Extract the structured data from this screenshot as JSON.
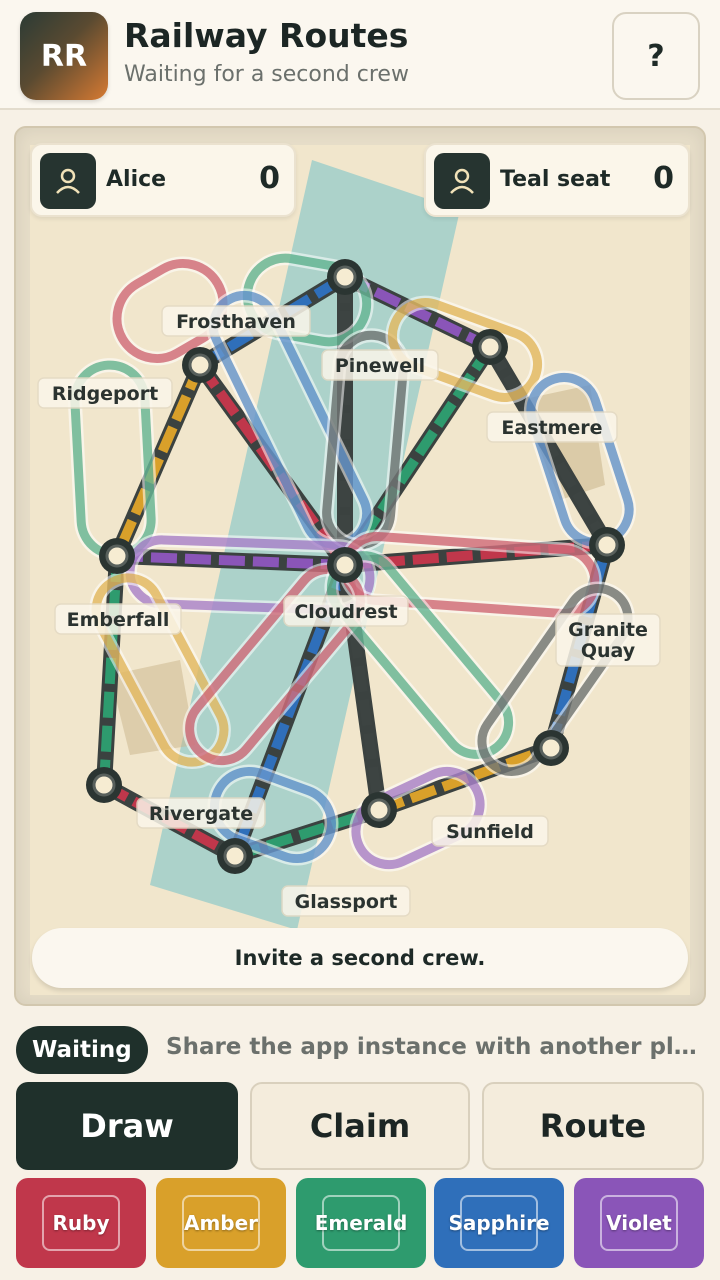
{
  "header": {
    "logo_text": "RR",
    "title": "Railway Routes",
    "subtitle": "Waiting for a second crew",
    "help_label": "?"
  },
  "players": [
    {
      "name": "Alice",
      "score": "0"
    },
    {
      "name": "Teal seat",
      "score": "0"
    }
  ],
  "cities": [
    {
      "name": "Frosthaven"
    },
    {
      "name": "Pinewell"
    },
    {
      "name": "Ridgeport"
    },
    {
      "name": "Eastmere"
    },
    {
      "name": "Emberfall"
    },
    {
      "name": "Cloudrest"
    },
    {
      "name": "Granite Quay"
    },
    {
      "name": "Rivergate"
    },
    {
      "name": "Sunfield"
    },
    {
      "name": "Glassport"
    }
  ],
  "invite_text": "Invite a second crew.",
  "status": {
    "pill": "Waiting",
    "message": "Share the app instance with another player."
  },
  "modes": [
    {
      "label": "Draw",
      "active": true
    },
    {
      "label": "Claim",
      "active": false
    },
    {
      "label": "Route",
      "active": false
    }
  ],
  "cards": [
    {
      "label": "Ruby",
      "color": "#c0374b"
    },
    {
      "label": "Amber",
      "color": "#d9a02a"
    },
    {
      "label": "Emerald",
      "color": "#2e9b6e"
    },
    {
      "label": "Sapphire",
      "color": "#2f6fba"
    },
    {
      "label": "Violet",
      "color": "#8a55b8"
    }
  ],
  "colors": {
    "ruby": "#c0374b",
    "amber": "#d9a02a",
    "emerald": "#2e9b6e",
    "sapphire": "#2f6fba",
    "violet": "#8a55b8",
    "track": "#3d4442",
    "river": "#7fc4c8",
    "board": "#f1e6cc"
  }
}
